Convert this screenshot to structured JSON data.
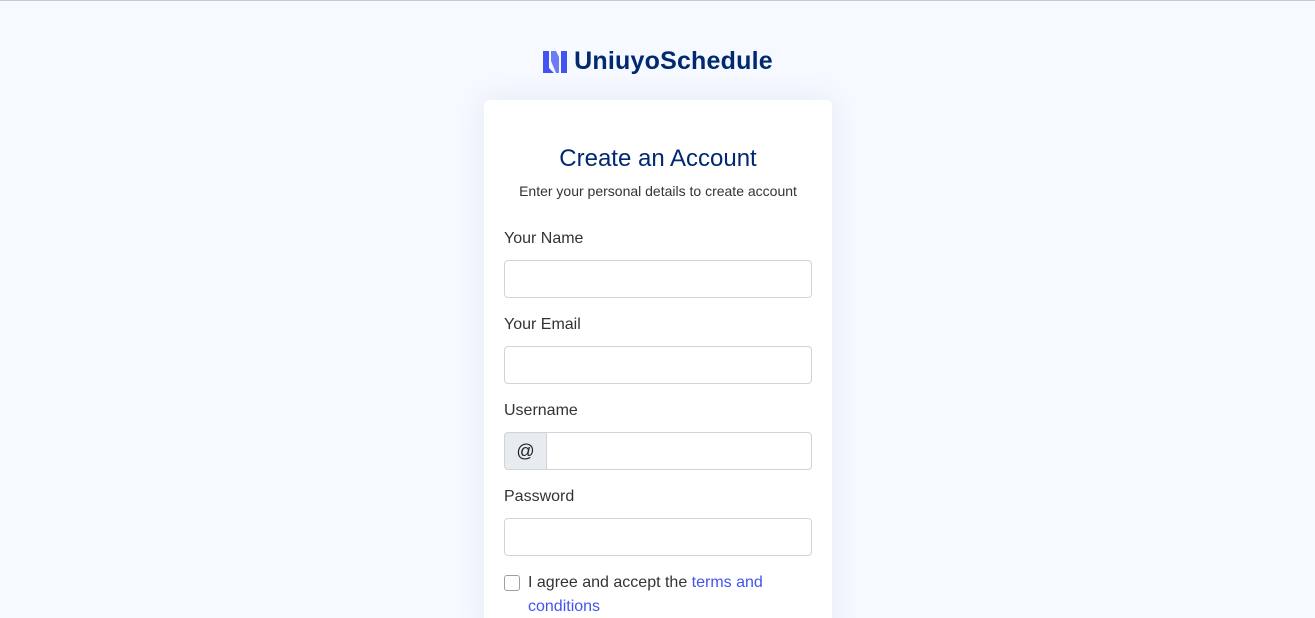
{
  "brand": {
    "name": "UniuyoSchedule",
    "logo_icon": "brand-logo-icon",
    "accent_color": "#4154f1",
    "title_color": "#012970"
  },
  "form": {
    "title": "Create an Account",
    "subtitle": "Enter your personal details to create account",
    "fields": {
      "name": {
        "label": "Your Name",
        "value": ""
      },
      "email": {
        "label": "Your Email",
        "value": ""
      },
      "username": {
        "label": "Username",
        "prefix": "@",
        "value": ""
      },
      "password": {
        "label": "Password",
        "value": ""
      }
    },
    "terms": {
      "text": "I agree and accept the ",
      "link_text": "terms and conditions",
      "checked": false
    }
  }
}
